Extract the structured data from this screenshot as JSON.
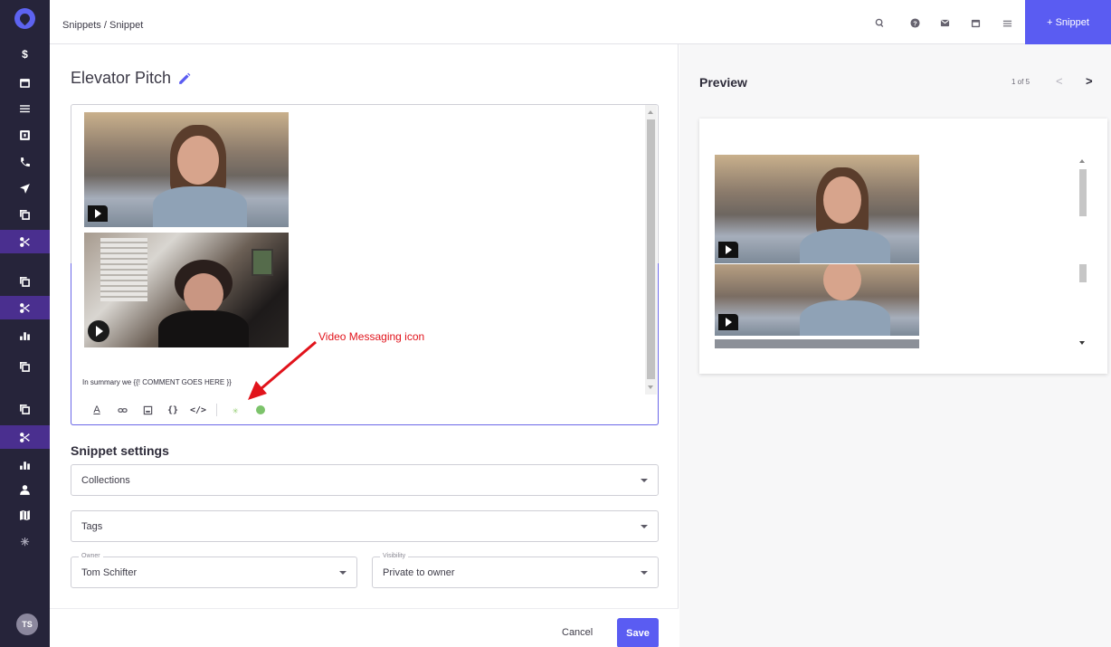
{
  "colors": {
    "accent": "#5a5cf2",
    "sidebar_bg": "#26243a",
    "sidebar_active": "#4a2f8f",
    "annotation": "#e1131b"
  },
  "sidebar": {
    "items": [
      {
        "icon": "dollar-icon"
      },
      {
        "icon": "calendar-icon"
      },
      {
        "icon": "task-list-icon"
      },
      {
        "icon": "inbox-icon"
      },
      {
        "icon": "phone-icon"
      },
      {
        "icon": "send-icon"
      },
      {
        "icon": "copy-icon"
      },
      {
        "icon": "scissors-icon",
        "active": true
      },
      {
        "icon": "copy-icon"
      },
      {
        "icon": "scissors-icon",
        "active": true
      },
      {
        "icon": "bar-chart-icon"
      },
      {
        "icon": "copy-icon"
      },
      {
        "icon": "copy-icon"
      },
      {
        "icon": "scissors-icon",
        "active": true
      },
      {
        "icon": "bar-chart-icon"
      },
      {
        "icon": "person-icon"
      },
      {
        "icon": "map-icon"
      },
      {
        "icon": "sparkle-icon"
      }
    ],
    "avatar_initials": "TS"
  },
  "header": {
    "breadcrumb": "Snippets / Snippet",
    "icons": [
      "search-icon",
      "help-icon",
      "mail-icon",
      "calendar-icon",
      "task-list-icon"
    ],
    "add_button": "+ Snippet"
  },
  "editor": {
    "title": "Elevator Pitch",
    "body_text": "In summary we {{! COMMENT GOES HERE }}",
    "toolbar": [
      "text-color-icon",
      "link-icon",
      "image-icon",
      "variable-icon",
      "code-icon",
      "sparkle-icon",
      "video-messaging-icon"
    ],
    "toolbar_labels": {
      "text": "A",
      "variable": "{}",
      "code": "</>"
    }
  },
  "annotation": {
    "label": "Video Messaging icon"
  },
  "settings": {
    "title": "Snippet settings",
    "collections_placeholder": "Collections",
    "tags_placeholder": "Tags",
    "owner_label": "Owner",
    "owner_value": "Tom Schifter",
    "visibility_label": "Visibility",
    "visibility_value": "Private to owner"
  },
  "footer": {
    "cancel": "Cancel",
    "save": "Save"
  },
  "preview": {
    "title": "Preview",
    "pager": "1 of 5",
    "prev": "<",
    "next": ">"
  }
}
